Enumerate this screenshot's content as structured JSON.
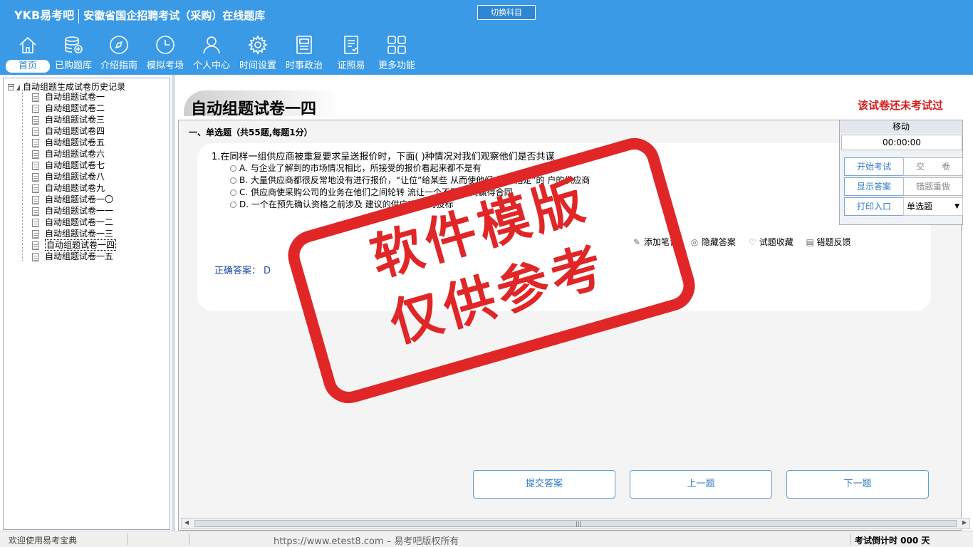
{
  "header": {
    "logo": "YKB易考吧",
    "subtitle": "安徽省国企招聘考试（采购）在线题库",
    "switch_label": "切换科目"
  },
  "nav": [
    {
      "label": "首页",
      "icon": "home-icon",
      "active": true
    },
    {
      "label": "已购题库",
      "icon": "database-icon"
    },
    {
      "label": "介绍指南",
      "icon": "compass-icon"
    },
    {
      "label": "模拟考场",
      "icon": "clock-icon"
    },
    {
      "label": "个人中心",
      "icon": "user-icon"
    },
    {
      "label": "时间设置",
      "icon": "gear-icon"
    },
    {
      "label": "时事政治",
      "icon": "newspaper-icon"
    },
    {
      "label": "证照易",
      "icon": "certificate-icon"
    },
    {
      "label": "更多功能",
      "icon": "grid-icon"
    }
  ],
  "tree": {
    "root": "自动组题生成试卷历史记录",
    "items": [
      "自动组题试卷一",
      "自动组题试卷二",
      "自动组题试卷三",
      "自动组题试卷四",
      "自动组题试卷五",
      "自动组题试卷六",
      "自动组题试卷七",
      "自动组题试卷八",
      "自动组题试卷九",
      "自动组题试卷一〇",
      "自动组题试卷一一",
      "自动组题试卷一二",
      "自动组题试卷一三",
      "自动组题试卷一四",
      "自动组题试卷一五"
    ],
    "selected_index": 13
  },
  "main": {
    "paper_title": "自动组题试卷一四",
    "status": "该试卷还未考试过",
    "section": "一、单选题（共55题,每题1分）",
    "question": {
      "stem": "1.在同样一组供应商被重复要求呈送报价时，下面( )种情况对我们观察他们是否共谋",
      "options": [
        "A. 与企业了解到的市场情况相比，所接受的报价看起来都不是有",
        "B. 大量供应商都很反常地没有进行报价，“让位”给某些        从而使他们成为“指定”的  户的供应商",
        "C. 供应商使采购公司的业务在他们之间轮转           流让一个不同的   商赢得合同",
        "D. 一个在预先确认资格之前涉及          建议的供应商            司的投标"
      ]
    },
    "tools": {
      "note": "添加笔记",
      "hide": "隐藏答案",
      "fav": "试题收藏",
      "report": "错题反馈"
    },
    "answer_label": "正确答案：",
    "answer_value": "D",
    "buttons": {
      "submit": "提交答案",
      "prev": "上一题",
      "next": "下一题"
    }
  },
  "panel": {
    "title": "移动",
    "timer": "00:00:00",
    "start": "开始考试",
    "hand_in": "交　　卷",
    "show_answer": "显示答案",
    "redo_wrong": "错题重做",
    "print": "打印入口",
    "qtype": "单选题"
  },
  "watermark": {
    "line1": "软件模版",
    "line2": "仅供参考"
  },
  "statusbar": {
    "welcome": "欢迎使用易考宝典",
    "copyright": "https://www.etest8.com – 易考吧版权所有",
    "countdown": "考试倒计时 000 天"
  },
  "colors": {
    "header": "#3a9ae6",
    "accent": "#2f7cc6",
    "status_red": "#d51f1f",
    "stamp_red": "#e02626"
  }
}
